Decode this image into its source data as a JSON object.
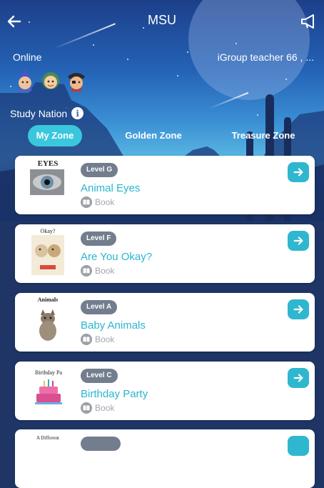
{
  "header": {
    "title": "MSU",
    "back_icon": "arrow-left-icon",
    "announce_icon": "megaphone-icon"
  },
  "online": {
    "label": "Online",
    "teacher": "iGroup teacher 66 , ...",
    "avatars": [
      "wizard-avatar",
      "girl-avatar",
      "pirate-avatar"
    ]
  },
  "nation": {
    "label": "Study Nation",
    "info_icon": "i"
  },
  "tabs": [
    {
      "label": "My Zone",
      "active": true
    },
    {
      "label": "Golden Zone",
      "active": false
    },
    {
      "label": "Treasure Zone",
      "active": false
    }
  ],
  "books": [
    {
      "cover_title": "EYES",
      "level": "Level G",
      "title": "Animal Eyes",
      "type": "Book"
    },
    {
      "cover_title": "Okay?",
      "level": "Level F",
      "title": "Are You Okay?",
      "type": "Book"
    },
    {
      "cover_title": "Animals",
      "level": "Level A",
      "title": "Baby Animals",
      "type": "Book"
    },
    {
      "cover_title": "Birthday Pa",
      "level": "Level C",
      "title": "Birthday Party",
      "type": "Book"
    },
    {
      "cover_title": "A Different",
      "level": "",
      "title": "",
      "type": ""
    }
  ],
  "colors": {
    "accent": "#2fb7d0",
    "badge": "#727d8e",
    "title_text": "#2bb5cf",
    "night_bg": "#1e3566"
  }
}
